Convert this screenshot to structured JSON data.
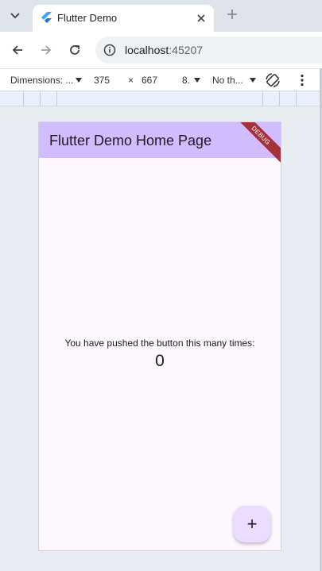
{
  "browser": {
    "tab": {
      "title": "Flutter Demo"
    },
    "url": {
      "host": "localhost",
      "port": ":45207"
    }
  },
  "device_toolbar": {
    "dimensions_label": "Dimensions: ...",
    "width": "375",
    "times": "×",
    "height": "667",
    "zoom": "8.",
    "throttling": "No th..."
  },
  "app": {
    "title": "Flutter Demo Home Page",
    "debug_banner": "DEBUG",
    "counter_text": "You have pushed the button this many times:",
    "counter_value": "0",
    "fab_label": "+"
  },
  "colors": {
    "app_bar": "#d0bcff",
    "surface": "#fef7ff",
    "fab": "#eaddff",
    "debug_banner": "#a3323a"
  }
}
